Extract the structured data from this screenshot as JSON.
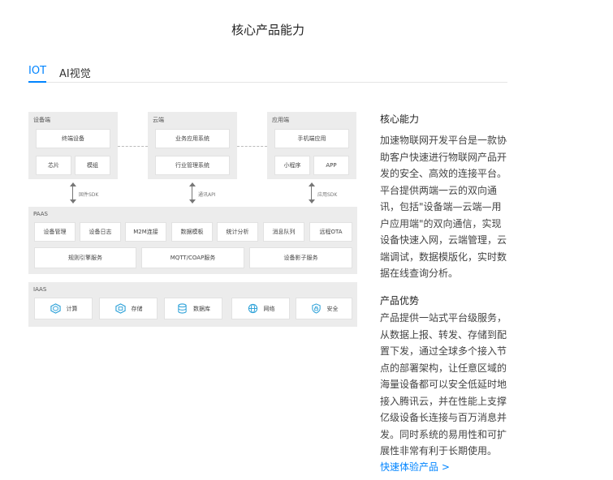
{
  "page": {
    "title": "核心产品能力"
  },
  "tabs": [
    {
      "label": "IOT",
      "active": true
    },
    {
      "label": "AI视觉",
      "active": false
    }
  ],
  "diagram": {
    "device": {
      "label": "设备端",
      "terminal": "终端设备",
      "chip": "芯片",
      "module": "模组"
    },
    "cloud": {
      "label": "云端",
      "business": "业务应用系统",
      "industry": "行业管理系统"
    },
    "app": {
      "label": "应用端",
      "mobile": "手机端应用",
      "miniprogram": "小程序",
      "app": "APP"
    },
    "arrows": {
      "firmware": "固件SDK",
      "comm": "通讯API",
      "appsdk": "应用SDK"
    },
    "paas": {
      "label": "PAAS",
      "row1": [
        "设备管理",
        "设备日志",
        "M2M连接",
        "数据模板",
        "统计分析",
        "消息队列",
        "远程OTA"
      ],
      "row2": [
        "规则引擎服务",
        "MQTT/COAP服务",
        "设备影子服务"
      ]
    },
    "iaas": {
      "label": "IAAS",
      "items": [
        {
          "label": "计算",
          "icon": "compute-icon"
        },
        {
          "label": "存储",
          "icon": "storage-icon"
        },
        {
          "label": "数据库",
          "icon": "database-icon"
        },
        {
          "label": "网络",
          "icon": "network-icon"
        },
        {
          "label": "安全",
          "icon": "security-icon"
        }
      ]
    }
  },
  "core": {
    "title": "核心能力",
    "lines": [
      "加速物联网开发平台是一款协",
      "助客户快速进行物联网产品开",
      "发的安全、高效的连接平台。",
      "平台提供两端一云的双向通",
      "讯，包括\"设备端—云端—用",
      "户应用端\"的双向通信，实现",
      "设备快速入网，云端管理，云",
      "端调试，数据模版化，实时数",
      "据在线查询分析。"
    ]
  },
  "advantage": {
    "title": "产品优势",
    "lines": [
      "产品提供一站式平台级服务，",
      "从数据上报、转发、存储到配",
      "置下发，通过全球多个接入节",
      "点的部署架构，让任意区域的",
      "海量设备都可以安全低延时地",
      "接入腾讯云，并在性能上支撑",
      "亿级设备长连接与百万消息并",
      "发。同时系统的易用性和可扩",
      "展性非常有利于长期使用。"
    ]
  },
  "link": {
    "label": "快速体验产品 >"
  },
  "colors": {
    "accent": "#0084ff",
    "panel": "#ececec",
    "icon": "#2aa0d8"
  }
}
